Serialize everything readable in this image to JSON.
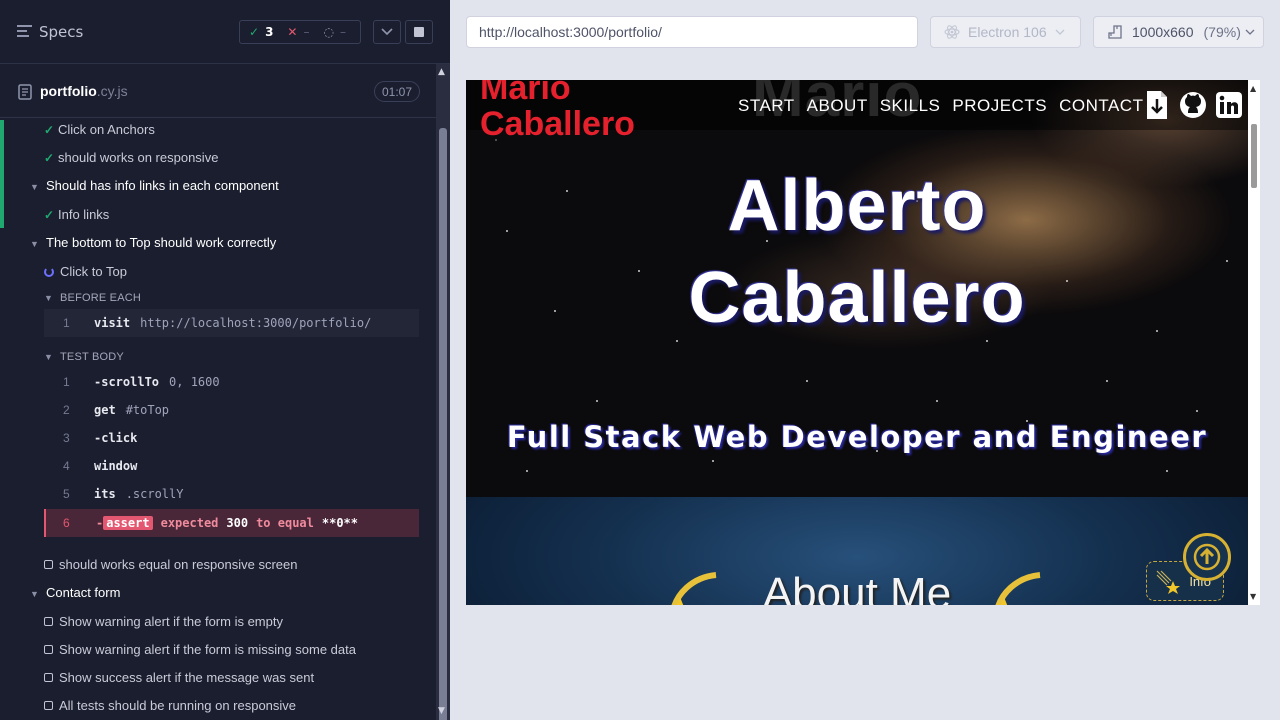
{
  "reporter": {
    "header": {
      "title": "Specs",
      "passed": "3",
      "failed": "–",
      "pending": "–"
    },
    "spec": {
      "name": "portfolio",
      "ext": ".cy.js",
      "duration": "01:07"
    },
    "tree": {
      "t1": "Click on Anchors",
      "t2": "should works on responsive",
      "s1": "Should has info links in each component",
      "t3": "Info links",
      "s2": "The bottom to Top should work correctly",
      "t4": "Click to Top",
      "before_each": "BEFORE EACH",
      "test_body": "TEST BODY",
      "t5": "should works equal on responsive screen",
      "s3": "Contact form",
      "t6": "Show warning alert if the form is empty",
      "t7": "Show warning alert if the form is missing some data",
      "t8": "Show success alert if the message was sent",
      "t9": "All tests should be running on responsive"
    },
    "before_commands": [
      {
        "num": "1",
        "name": "visit",
        "arg": "http://localhost:3000/portfolio/"
      }
    ],
    "body_commands": [
      {
        "num": "1",
        "name": "-scrollTo",
        "arg": "0, 1600"
      },
      {
        "num": "2",
        "name": "get",
        "arg": "#toTop"
      },
      {
        "num": "3",
        "name": "-click",
        "arg": ""
      },
      {
        "num": "4",
        "name": "window",
        "arg": ""
      },
      {
        "num": "5",
        "name": "its",
        "arg": ".scrollY"
      }
    ],
    "failed_command": {
      "num": "6",
      "dash": "-",
      "badge": "assert",
      "w1": "expected",
      "v1": "300",
      "w2": "to equal",
      "v2": "**0**"
    }
  },
  "browser": {
    "url": "http://localhost:3000/portfolio/",
    "browser_name": "Electron 106",
    "viewport": "1000x660",
    "zoom": "(79%)"
  },
  "site": {
    "brand": "Mario Caballero",
    "ghost_text": "Mario",
    "nav": [
      "START",
      "ABOUT",
      "SKILLS",
      "PROJECTS",
      "CONTACT"
    ],
    "hero_line1": "Alberto",
    "hero_line2": "Caballero",
    "subtitle": "Full Stack Web Developer and Engineer",
    "about_title": "About Me",
    "info_label": "Info"
  },
  "colors": {
    "pass": "#1fa971",
    "fail": "#e45770",
    "brand_red": "#e5212d",
    "button_gold": "#d7b132"
  }
}
